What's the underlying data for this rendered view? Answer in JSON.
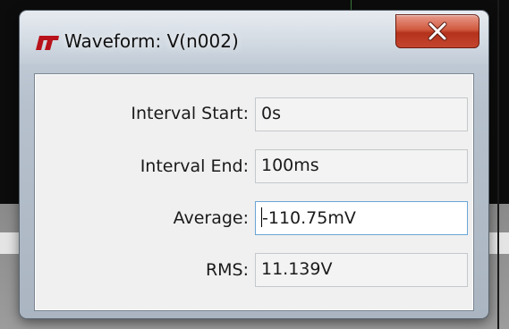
{
  "window": {
    "title": "Waveform: V(n002)",
    "app_icon": "lt-logo-icon",
    "close_icon": "close-icon"
  },
  "fields": [
    {
      "label": "Interval Start:",
      "value": "0s",
      "editable": false
    },
    {
      "label": "Interval End:",
      "value": "100ms",
      "editable": false
    },
    {
      "label": "Average:",
      "value": "-110.75mV",
      "editable": true
    },
    {
      "label": "RMS:",
      "value": "11.139V",
      "editable": false
    }
  ],
  "colors": {
    "close_button": "#c4462e",
    "logo_red": "#b8121b",
    "field_focus_border": "#6aa6d6"
  }
}
